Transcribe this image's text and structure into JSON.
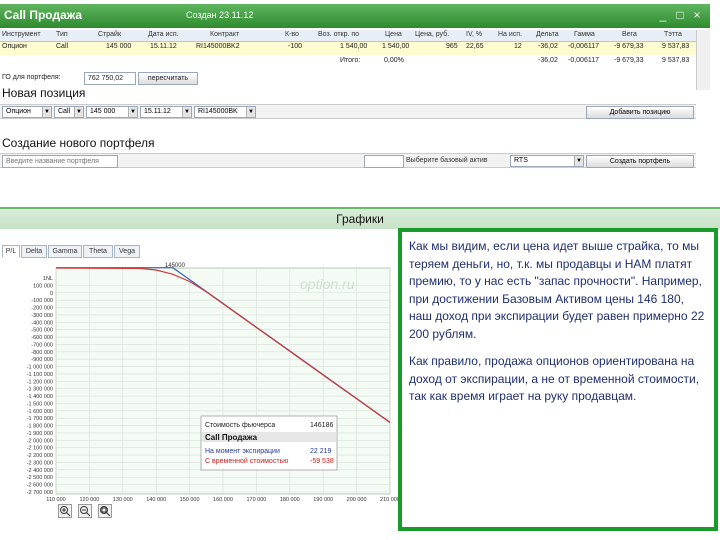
{
  "window": {
    "title": "Call Продажа",
    "created": "Создан 23.11.12",
    "controls": [
      "_",
      "□",
      "×"
    ]
  },
  "grid": {
    "columns": [
      "Инструмент",
      "Тип",
      "Страйк",
      "Дата исп.",
      "Контракт",
      "К-во",
      "Воз. откр. по",
      "Цена",
      "Цена, руб.",
      "IV, %",
      "На исп.",
      "Дельта",
      "Гамма",
      "Вега",
      "Тэтта"
    ],
    "row": [
      "Опцион",
      "Call",
      "145 000",
      "15.11.12",
      "RI145000BK2",
      "-100",
      "1 540,00",
      "1 540,00",
      "965",
      "22,65",
      "12",
      "-36,02",
      "-0,006117",
      "-9 679,33",
      "9 537,83"
    ],
    "total_label": "Итого:",
    "total_value": "0,00%",
    "totals": [
      "-36,02",
      "-0,006117",
      "-9 679,33",
      "9 537,83"
    ]
  },
  "go_portfolio": {
    "label": "ГО для портфеля:",
    "value": "762 750,02",
    "button": "пересчитать"
  },
  "new_position": {
    "heading": "Новая позиция",
    "type": "Опцион",
    "kind": "Call",
    "strike": "145 000",
    "date": "15.11.12",
    "contract": "RI145000BK",
    "add_button": "Добавить позицию"
  },
  "new_portfolio": {
    "heading": "Создание нового портфеля",
    "name_placeholder": "Введите название портфеля",
    "base_asset_label": "Выберите базовый актив",
    "base_asset_value": "RTS",
    "create_button": "Создать портфель"
  },
  "charts": {
    "heading": "Графики",
    "tabs": [
      "P/L",
      "Delta",
      "Gamma",
      "Theta",
      "Vega"
    ],
    "active_tab": "P/L",
    "watermark": "option.ru",
    "zoom_icons": [
      "zoom-in-icon",
      "zoom-out-icon",
      "zoom-reset-icon"
    ]
  },
  "chart_data": {
    "type": "line",
    "x_ticks": [
      "110 000",
      "120 000",
      "130 000",
      "140 000",
      "150 000",
      "160 000",
      "170 000",
      "180 000",
      "190 000",
      "200 000",
      "210 000"
    ],
    "y_ticks": [
      "1NL",
      "100 000",
      "0",
      "-100 000",
      "-200 000",
      "-300 000",
      "-400 000",
      "-500 000",
      "-600 000",
      "-700 000",
      "-800 000",
      "-900 000",
      "-1 000 000",
      "-1 100 000",
      "-1 200 000",
      "-1 300 000",
      "-1 400 000",
      "-1 500 000",
      "-1 600 000",
      "-1 700 000",
      "-1 800 000",
      "-1 900 000",
      "-2 000 000",
      "-2 100 000",
      "-2 200 000",
      "-2 300 000",
      "-2 400 000",
      "-2 500 000",
      "-2 600 000",
      "-2 700 000"
    ],
    "xlim": [
      110000,
      210000
    ],
    "ylim": [
      -2700000,
      150000
    ],
    "strike_marker": "145000",
    "grid": true,
    "series": [
      {
        "name": "На момент экспирации",
        "color": "#3a5fb0",
        "x": [
          110000,
          145000,
          150000,
          160000,
          170000,
          180000,
          190000,
          200000,
          210000
        ],
        "y": [
          154000,
          154000,
          4000,
          -296000,
          -596000,
          -896000,
          -1196000,
          -1496000,
          -1796000
        ]
      },
      {
        "name": "С временной стоимостью",
        "color": "#d23a3a",
        "x": [
          110000,
          135000,
          140000,
          145000,
          150000,
          155000,
          160000,
          170000,
          180000,
          190000,
          200000,
          210000
        ],
        "y": [
          150000,
          145000,
          125000,
          70000,
          -20000,
          -150000,
          -300000,
          -600000,
          -900000,
          -1200000,
          -1500000,
          -1800000
        ]
      }
    ],
    "tooltip": {
      "label": "Стоимость фьючерса",
      "value": "146186",
      "title": "Call Продажа",
      "rows": [
        {
          "label": "На момент экспирации",
          "value": "22 219",
          "color": "#2a3c8f"
        },
        {
          "label": "С временной стоимостью",
          "value": "-59 538",
          "color": "#c42020"
        }
      ]
    }
  },
  "overlay_text": {
    "p1": "Как мы видим, если цена идет выше страйка, то мы теряем деньги, но, т.к. мы продавцы и НАМ платят премию, то у нас есть \"запас прочности\". Например, при достижении Базовым Активом цены 146 180, наш доход при экспирации будет равен примерно 22 200 рублям.",
    "p2": "Как правило, продажа опционов ориентирована на доход от экспирации, а не от временной стоимости, так как время играет на руку продавцам."
  }
}
